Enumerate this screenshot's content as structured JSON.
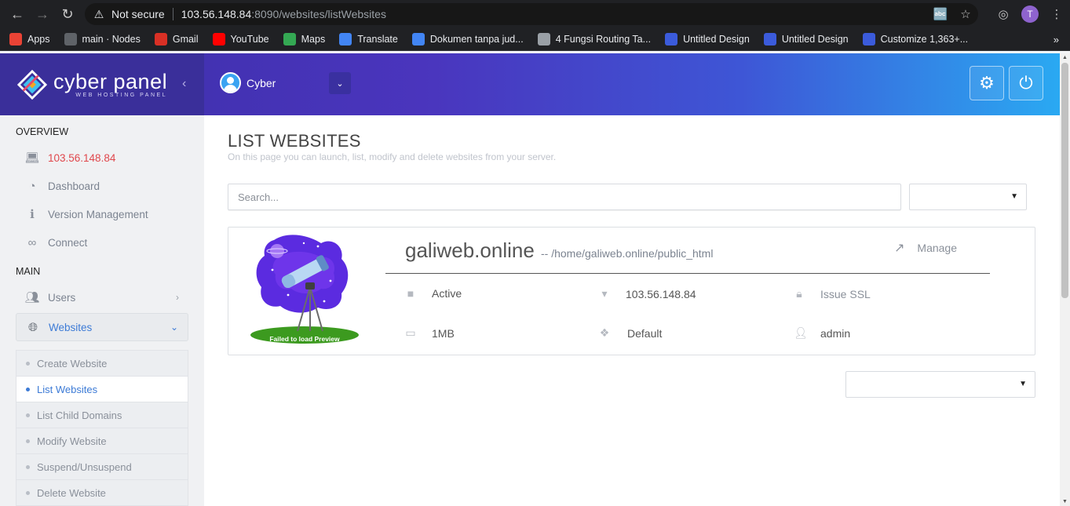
{
  "browser": {
    "security_label": "Not secure",
    "url_host": "103.56.148.84",
    "url_path": ":8090/websites/listWebsites",
    "profile_initial": "T",
    "bookmarks": [
      {
        "label": "Apps",
        "color": "#ea4335"
      },
      {
        "label": "main · Nodes",
        "color": "#5f6368"
      },
      {
        "label": "Gmail",
        "color": "#d93025"
      },
      {
        "label": "YouTube",
        "color": "#ff0000"
      },
      {
        "label": "Maps",
        "color": "#34a853"
      },
      {
        "label": "Translate",
        "color": "#4285f4"
      },
      {
        "label": "Dokumen tanpa jud...",
        "color": "#4285f4"
      },
      {
        "label": "4 Fungsi Routing Ta...",
        "color": "#9aa0a6"
      },
      {
        "label": "Untitled Design",
        "color": "#3b5bdb"
      },
      {
        "label": "Untitled Design",
        "color": "#3b5bdb"
      },
      {
        "label": "Customize 1,363+...",
        "color": "#3b5bdb"
      }
    ],
    "more_label": "»"
  },
  "header": {
    "logo_text": "cyber panel",
    "logo_sub": "WEB HOSTING PANEL",
    "user_name": "Cyber",
    "accent": "#3c2fa8"
  },
  "sidebar": {
    "overview_title": "OVERVIEW",
    "main_title": "MAIN",
    "items": {
      "ip": "103.56.148.84",
      "dashboard": "Dashboard",
      "version": "Version Management",
      "connect": "Connect",
      "users": "Users",
      "websites": "Websites"
    },
    "submenu": [
      "Create Website",
      "List Websites",
      "List Child Domains",
      "Modify Website",
      "Suspend/Unsuspend",
      "Delete Website"
    ]
  },
  "main": {
    "title": "LIST WEBSITES",
    "subtitle": "On this page you can launch, list, modify and delete websites from your server.",
    "search_placeholder": "Search...",
    "site": {
      "preview_label": "Failed to load Preview",
      "domain": "galiweb.online",
      "docroot": "-- /home/galiweb.online/public_html",
      "manage_label": "Manage",
      "status": "Active",
      "ip": "103.56.148.84",
      "ssl": "Issue SSL",
      "disk": "1MB",
      "package": "Default",
      "owner": "admin"
    }
  }
}
